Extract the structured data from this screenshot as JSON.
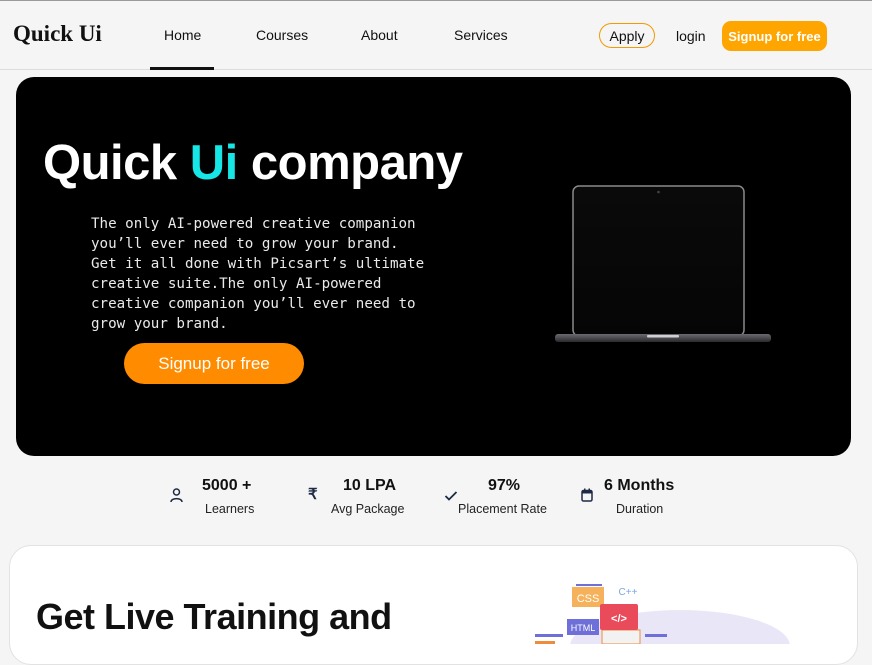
{
  "brand": {
    "logo": "Quick Ui"
  },
  "nav": {
    "links": [
      "Home",
      "Courses",
      "About",
      "Services"
    ],
    "active": "Home",
    "apply_label": "Apply",
    "login_label": "login",
    "signup_label": "Signup for free"
  },
  "hero": {
    "title_part1": "Quick ",
    "title_accent": "Ui",
    "title_part2": " company",
    "description": "The only AI-powered creative companion you’ll ever need to grow your brand. Get it all done with Picsart’s ultimate creative suite.The only AI-powered creative companion you’ll ever need to grow your brand.",
    "cta_label": "Signup for free"
  },
  "stats": [
    {
      "value": "5000 +",
      "label": "Learners",
      "icon": "user-icon"
    },
    {
      "value": "10 LPA",
      "label": "Avg Package",
      "icon": "rupee-icon"
    },
    {
      "value": "97%",
      "label": "Placement Rate",
      "icon": "check-icon"
    },
    {
      "value": "6 Months",
      "label": "Duration",
      "icon": "calendar-icon"
    }
  ],
  "section": {
    "title": "Get Live Training and",
    "illustration_labels": [
      "CSS",
      "C++",
      "HTML",
      "</>"
    ]
  },
  "colors": {
    "accent_orange": "#ffa500",
    "hero_cta": "#ff8c00",
    "accent_cyan": "#16e6e6",
    "hero_bg": "#000000"
  }
}
